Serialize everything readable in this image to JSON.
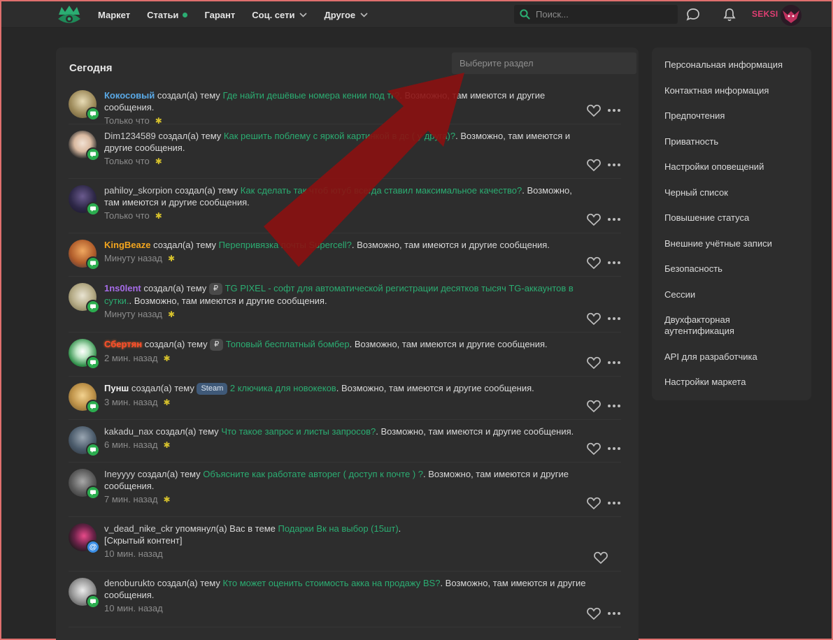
{
  "header": {
    "nav": [
      {
        "label": "Маркет"
      },
      {
        "label": "Статьи"
      },
      {
        "label": "Гарант"
      },
      {
        "label": "Соц. сети"
      },
      {
        "label": "Другое"
      }
    ],
    "search_placeholder": "Поиск...",
    "username": "SEKSI"
  },
  "main": {
    "title": "Сегодня",
    "section_placeholder": "Выберите раздел",
    "items": [
      {
        "user": "Кокосовый",
        "action": "создал(а) тему",
        "prefix": "",
        "topic": "Где найти дешёвые номера кении под тг?",
        "suffix": ". Возможно, там имеются и другие сообщения.",
        "time": "Только что"
      },
      {
        "user": "Dim1234589",
        "action": "создал(а) тему",
        "prefix": "",
        "topic": "Как решить поблему с яркой картинкой в дс ( у друга)?",
        "suffix": ". Возможно, там имеются и другие сообщения.",
        "time": "Только что"
      },
      {
        "user": "pahiloy_skorpion",
        "action": "создал(а) тему",
        "prefix": "",
        "topic": "Как сделать так чтоб ютуб всегда ставил максимальное качество?",
        "suffix": ". Возможно, там имеются и другие сообщения.",
        "time": "Только что"
      },
      {
        "user": "KingBeaze",
        "action": "создал(а) тему",
        "prefix": "",
        "topic": "Перепривязка почты Supercell?",
        "suffix": ". Возможно, там имеются и другие сообщения.",
        "time": "Минуту назад"
      },
      {
        "user": "1ns0lent",
        "action": "создал(а) тему",
        "prefix": "₽",
        "topic": "TG PIXEL - софт для автоматической регистрации десятков тысяч TG-аккаунтов в сутки.",
        "suffix": ". Возможно, там имеются и другие сообщения.",
        "time": "Минуту назад"
      },
      {
        "user": "Сбертян",
        "action": "создал(а) тему",
        "prefix": "₽",
        "topic": "Топовый бесплатный бомбер",
        "suffix": ". Возможно, там имеются и другие сообщения.",
        "time": "2 мин. назад"
      },
      {
        "user": "Пунш",
        "action": "создал(а) тему",
        "prefix": "Steam",
        "topic": "2 ключика для новокеков",
        "suffix": ". Возможно, там имеются и другие сообщения.",
        "time": "3 мин. назад"
      },
      {
        "user": "kakadu_nax",
        "action": "создал(а) тему",
        "prefix": "",
        "topic": "Что такое запрос и листы запросов?",
        "suffix": ". Возможно, там имеются и другие сообщения.",
        "time": "6 мин. назад"
      },
      {
        "user": "Ineyyyy",
        "action": "создал(а) тему",
        "prefix": "",
        "topic": "Объясните как работате авторег ( доступ к почте ) ?",
        "suffix": ". Возможно, там имеются и другие сообщения.",
        "time": "7 мин. назад"
      },
      {
        "user": "v_dead_nike_ckr",
        "action": "упомянул(а) Вас в теме",
        "prefix": "",
        "topic": "Подарки Вк на выбор (15шт)",
        "suffix": ".",
        "extra": "[Скрытый контент]",
        "time": "10 мин. назад"
      },
      {
        "user": "denoburukto",
        "action": "создал(а) тему",
        "prefix": "",
        "topic": "Кто может оценить стоимость акка на продажу BS?",
        "suffix": ". Возможно, там имеются и другие сообщения.",
        "time": "10 мин. назад"
      }
    ]
  },
  "sidebar": {
    "items": [
      {
        "label": "Персональная информация"
      },
      {
        "label": "Контактная информация"
      },
      {
        "label": "Предпочтения"
      },
      {
        "label": "Приватность"
      },
      {
        "label": "Настройки оповещений"
      },
      {
        "label": "Черный список"
      },
      {
        "label": "Повышение статуса"
      },
      {
        "label": "Внешние учётные записи"
      },
      {
        "label": "Безопасность"
      },
      {
        "label": "Сессии"
      },
      {
        "label": "Двухфакторная аутентификация"
      },
      {
        "label": "API для разработчика"
      },
      {
        "label": "Настройки маркета"
      }
    ]
  },
  "colors": {
    "accent": "#2bad72",
    "username": "#e03e73",
    "background": "#272727",
    "panel": "#2d2d2d"
  },
  "icons": [
    "logo-icon",
    "search-icon",
    "chat-icon",
    "bell-icon",
    "heart-icon",
    "more-icon",
    "chevron-down-icon",
    "message-badge-icon",
    "mention-badge-icon",
    "star-icon"
  ]
}
